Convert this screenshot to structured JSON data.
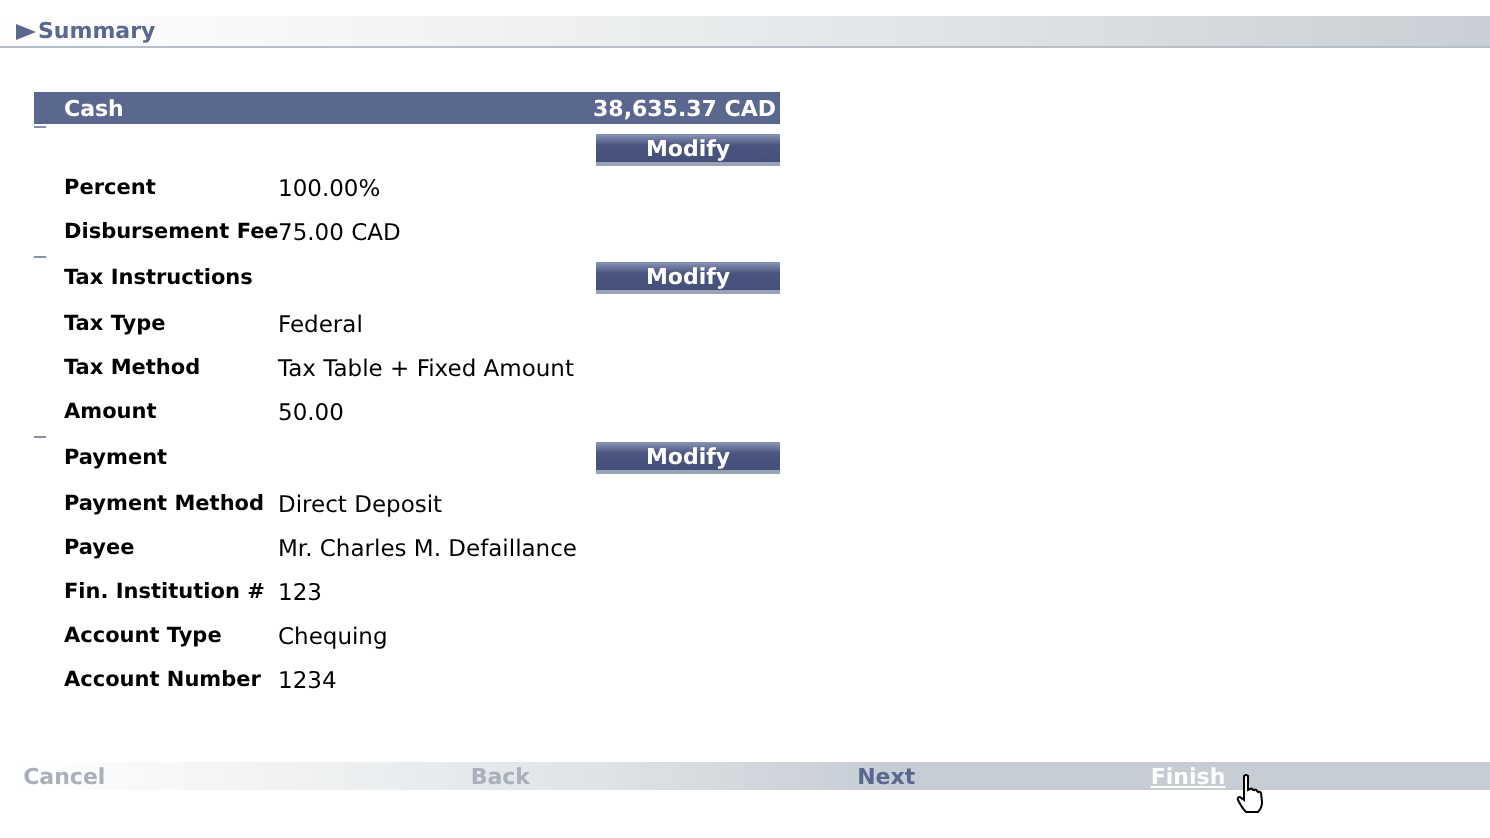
{
  "title": "Summary",
  "sections": [
    {
      "kind": "header",
      "title": "Cash",
      "amount": "38,635.37 CAD",
      "button": "Modify",
      "rows": [
        {
          "label": "Percent",
          "value": "100.00%"
        },
        {
          "label": "Disbursement Fee",
          "value": "75.00 CAD"
        }
      ]
    },
    {
      "kind": "subheading",
      "title": "Tax Instructions",
      "button": "Modify",
      "rows": [
        {
          "label": "Tax Type",
          "value": "Federal"
        },
        {
          "label": "Tax Method",
          "value": "Tax Table + Fixed Amount"
        },
        {
          "label": "Amount",
          "value": "50.00"
        }
      ]
    },
    {
      "kind": "subheading",
      "title": "Payment",
      "button": "Modify",
      "rows": [
        {
          "label": "Payment Method",
          "value": "Direct Deposit"
        },
        {
          "label": "Payee",
          "value": "Mr. Charles M. Defaillance"
        },
        {
          "label": "Fin. Institution #",
          "value": "123"
        },
        {
          "label": "Account Type",
          "value": "Chequing"
        },
        {
          "label": "Account Number",
          "value": "1234"
        }
      ]
    }
  ],
  "footer": [
    {
      "label": "Cancel",
      "disabled": true,
      "hovered": false
    },
    {
      "label": "Back",
      "disabled": true,
      "hovered": false
    },
    {
      "label": "Next",
      "disabled": false,
      "hovered": false
    },
    {
      "label": "Finish",
      "disabled": false,
      "hovered": true
    }
  ]
}
